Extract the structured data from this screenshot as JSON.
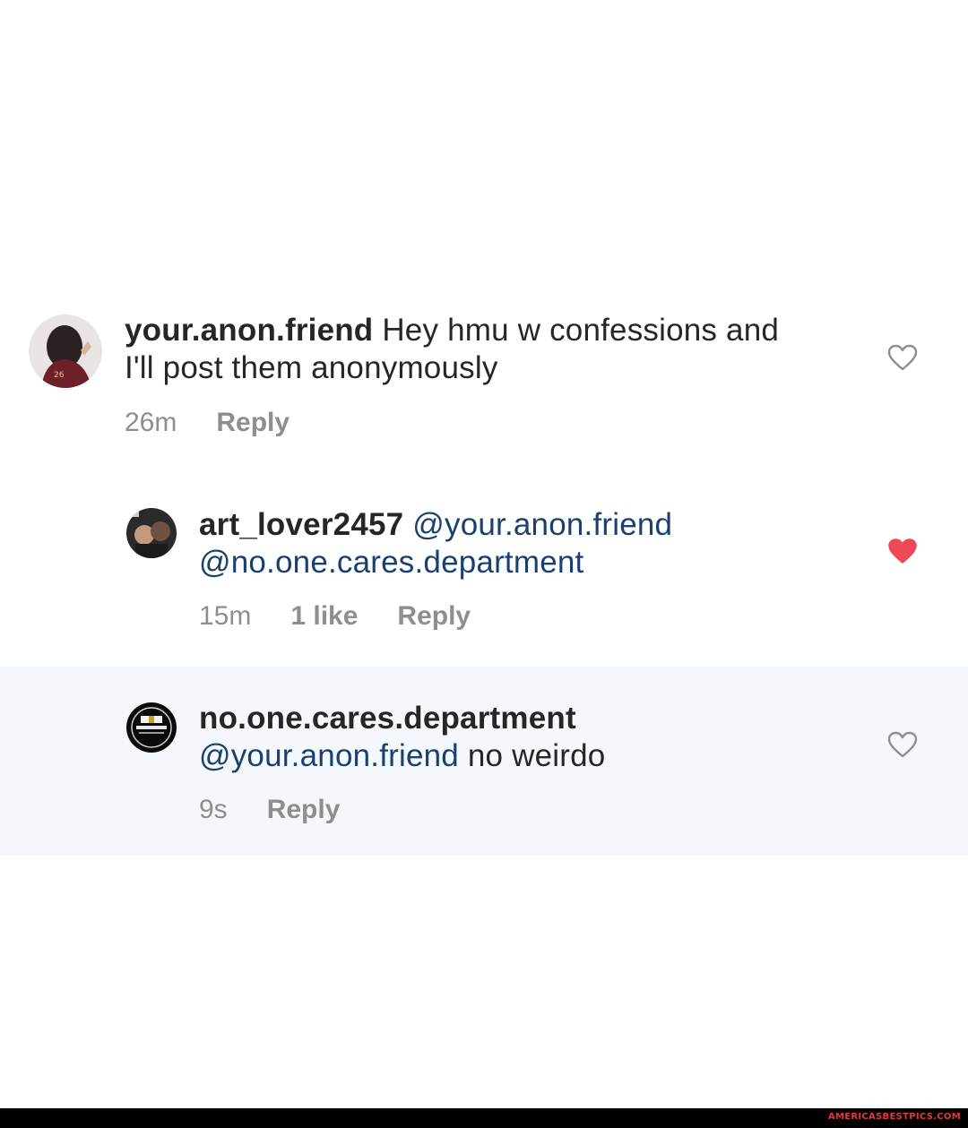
{
  "comments": [
    {
      "username": "your.anon.friend",
      "text": " Hey hmu w confessions and",
      "text_line2": "I'll post them anonymously",
      "time": "26m",
      "reply": "Reply",
      "liked": false
    },
    {
      "username": "art_lover2457",
      "mention1": "@your.anon.friend",
      "mention2": "@no.one.cares.department",
      "time": "15m",
      "likes": "1 like",
      "reply": "Reply",
      "liked": true
    },
    {
      "username": "no.one.cares.department",
      "mention": "@your.anon.friend",
      "text": " no weirdo",
      "time": "9s",
      "reply": "Reply",
      "liked": false
    }
  ],
  "footer": {
    "brand": "AMERICASBESTPICS.COM"
  },
  "colors": {
    "heart_liked": "#ed4956",
    "mention": "#1b3f6e",
    "highlight": "#f4f8fd"
  }
}
